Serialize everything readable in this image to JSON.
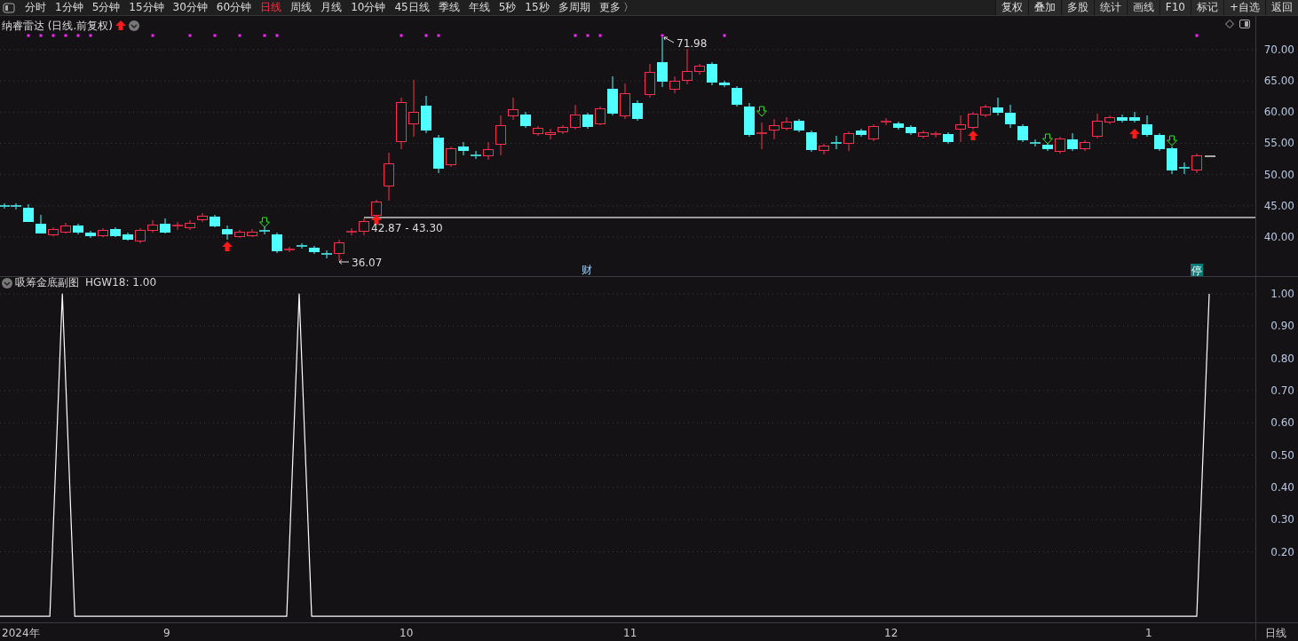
{
  "toolbar": {
    "periods": [
      {
        "label": "分时",
        "selected": false
      },
      {
        "label": "1分钟",
        "selected": false
      },
      {
        "label": "5分钟",
        "selected": false
      },
      {
        "label": "15分钟",
        "selected": false
      },
      {
        "label": "30分钟",
        "selected": false
      },
      {
        "label": "60分钟",
        "selected": false
      },
      {
        "label": "日线",
        "selected": true
      },
      {
        "label": "周线",
        "selected": false
      },
      {
        "label": "月线",
        "selected": false
      },
      {
        "label": "10分钟",
        "selected": false
      },
      {
        "label": "45日线",
        "selected": false
      },
      {
        "label": "季线",
        "selected": false
      },
      {
        "label": "年线",
        "selected": false
      },
      {
        "label": "5秒",
        "selected": false
      },
      {
        "label": "15秒",
        "selected": false
      },
      {
        "label": "多周期",
        "selected": false
      },
      {
        "label": "更多 〉",
        "selected": false
      }
    ],
    "actions": [
      "复权",
      "叠加",
      "多股",
      "统计",
      "画线",
      "F10",
      "标记",
      "+自选",
      "返回"
    ]
  },
  "main_chart": {
    "title": "纳睿雷达 (日线.前复权)",
    "price_labels": [
      "70.00",
      "65.00",
      "60.00",
      "55.00",
      "50.00",
      "45.00",
      "40.00"
    ],
    "annotations": [
      {
        "kind": "high",
        "text": "71.98"
      },
      {
        "kind": "range",
        "text": "42.87 - 43.30"
      },
      {
        "kind": "low",
        "text": "36.07"
      }
    ],
    "markers": [
      {
        "kind": "finance",
        "text": "财"
      },
      {
        "kind": "halt",
        "text": "停"
      }
    ]
  },
  "indicator": {
    "name": "吸筹金底副图",
    "reading": "HGW18: 1.00",
    "chart_data": {
      "type": "line",
      "ylim": [
        -0.074,
        1
      ],
      "grid": true,
      "yticks": [
        {
          "value": 1,
          "label": "1.00"
        },
        {
          "value": 0.9,
          "label": "0.90"
        },
        {
          "value": 0.8,
          "label": "0.80"
        },
        {
          "value": 0.7,
          "label": "0.70"
        },
        {
          "value": 0.6,
          "label": "0.60"
        },
        {
          "value": 0.5,
          "label": "0.50"
        },
        {
          "value": 0.4,
          "label": "0.40"
        },
        {
          "value": 0.3,
          "label": "0.30"
        },
        {
          "value": 0.2,
          "label": "0.20"
        }
      ],
      "series": [
        {
          "color": "#ffffff",
          "values": [
            0,
            0,
            0,
            0,
            0,
            1,
            0,
            0,
            0,
            0,
            0,
            0,
            0,
            0,
            0,
            0,
            0,
            0,
            0,
            0,
            0,
            0,
            0,
            0,
            1,
            0,
            0,
            0,
            0,
            0,
            0,
            0,
            0,
            0,
            0,
            0,
            0,
            0,
            0,
            0,
            0,
            0,
            0,
            0,
            0,
            0,
            0,
            0,
            0,
            0,
            0,
            0,
            0,
            0,
            0,
            0,
            0,
            0,
            0,
            0,
            0,
            0,
            0,
            0,
            0,
            0,
            0,
            0,
            0,
            0,
            0,
            0,
            0,
            0,
            0,
            0,
            0,
            0,
            0,
            0,
            0,
            0,
            0,
            0,
            0,
            0,
            0,
            0,
            0,
            0,
            0,
            0,
            0,
            0,
            0,
            0,
            0,
            1
          ]
        }
      ]
    }
  },
  "x_axis": {
    "labels": [
      "2024年",
      "9",
      "10",
      "11",
      "12",
      "1"
    ],
    "period": "日线"
  }
}
